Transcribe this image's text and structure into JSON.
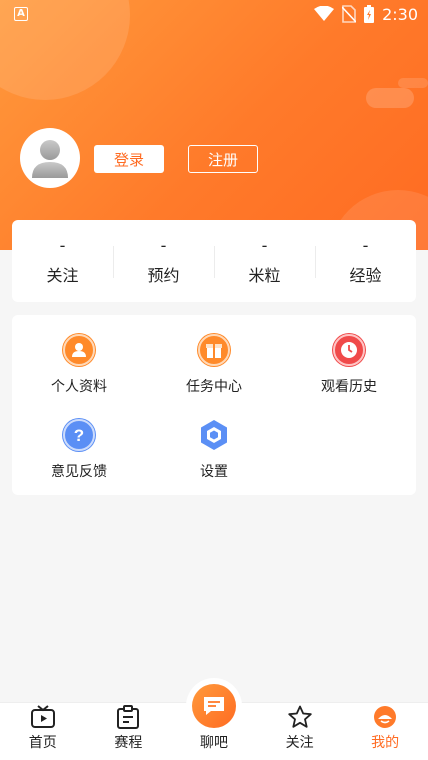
{
  "status_bar": {
    "time": "2:30",
    "icons": [
      "wifi-icon",
      "no-sim-icon",
      "battery-charging-icon"
    ],
    "app_icon": "A"
  },
  "header": {
    "avatar": "default-user-avatar",
    "login_label": "登录",
    "register_label": "注册"
  },
  "stats": [
    {
      "value": "-",
      "label": "关注"
    },
    {
      "value": "-",
      "label": "预约"
    },
    {
      "value": "-",
      "label": "米粒"
    },
    {
      "value": "-",
      "label": "经验"
    }
  ],
  "menu": [
    {
      "label": "个人资料",
      "icon": "profile-icon",
      "color": "#ff8a2a"
    },
    {
      "label": "任务中心",
      "icon": "gift-icon",
      "color": "#ff8a2a"
    },
    {
      "label": "观看历史",
      "icon": "clock-icon",
      "color": "#f04a4a"
    },
    {
      "label": "意见反馈",
      "icon": "question-icon",
      "color": "#5b8ff5"
    },
    {
      "label": "设置",
      "icon": "hexagon-settings-icon",
      "color": "#5b8ff5"
    }
  ],
  "bottom_nav": [
    {
      "label": "首页",
      "icon": "tv-play-icon"
    },
    {
      "label": "赛程",
      "icon": "schedule-clipboard-icon"
    },
    {
      "label": "聊吧",
      "icon": "chat-bubble-icon"
    },
    {
      "label": "关注",
      "icon": "star-icon"
    },
    {
      "label": "我的",
      "icon": "profile-face-icon",
      "active": true
    }
  ],
  "colors": {
    "accent": "#ff6b22",
    "background": "#f6f6f6"
  }
}
